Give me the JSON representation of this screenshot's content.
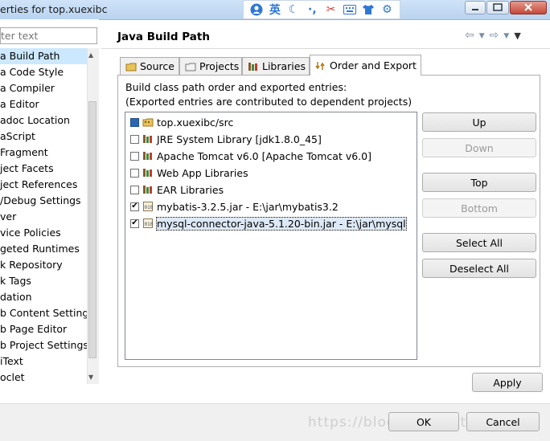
{
  "window": {
    "title": "erties for top.xuexibc",
    "ime_icons": [
      "user-icon",
      "ying-icon",
      "moon-icon",
      "dot-icon",
      "scissors-icon",
      "keyboard-icon",
      "shirt-icon",
      "gear-icon"
    ],
    "ime_ying": "英"
  },
  "left": {
    "filter_placeholder": "ter text",
    "items": [
      {
        "label": "a Build Path",
        "selected": true
      },
      {
        "label": "a Code Style"
      },
      {
        "label": "a Compiler"
      },
      {
        "label": "a Editor"
      },
      {
        "label": "adoc Location"
      },
      {
        "label": "aScript"
      },
      {
        "label": " Fragment"
      },
      {
        "label": "ject Facets"
      },
      {
        "label": "ject References"
      },
      {
        "label": "/Debug Settings"
      },
      {
        "label": "ver"
      },
      {
        "label": "vice Policies"
      },
      {
        "label": "geted Runtimes"
      },
      {
        "label": "k Repository"
      },
      {
        "label": "k Tags"
      },
      {
        "label": "dation"
      },
      {
        "label": "b Content Settings"
      },
      {
        "label": "b Page Editor"
      },
      {
        "label": "b Project Settings"
      },
      {
        "label": "iText"
      },
      {
        "label": "oclet"
      }
    ]
  },
  "header": {
    "title": "Java Build Path"
  },
  "tabs": [
    {
      "label": "Source"
    },
    {
      "label": "Projects"
    },
    {
      "label": "Libraries"
    },
    {
      "label": "Order and Export",
      "active": true
    }
  ],
  "order_export": {
    "line1": "Build class path order and exported entries:",
    "line2": "(Exported entries are contributed to dependent projects)",
    "entries": [
      {
        "label": "top.xuexibc/src",
        "checked": "filled",
        "icon": "source-folder-icon"
      },
      {
        "label": "JRE System Library [jdk1.8.0_45]",
        "checked": "no",
        "icon": "library-icon"
      },
      {
        "label": "Apache Tomcat v6.0 [Apache Tomcat v6.0]",
        "checked": "no",
        "icon": "library-icon"
      },
      {
        "label": "Web App Libraries",
        "checked": "no",
        "icon": "library-icon"
      },
      {
        "label": "EAR Libraries",
        "checked": "no",
        "icon": "library-icon"
      },
      {
        "label": "mybatis-3.2.5.jar - E:\\jar\\mybatis3.2",
        "checked": "yes",
        "icon": "jar-icon"
      },
      {
        "label": "mysql-connector-java-5.1.20-bin.jar - E:\\jar\\mysql",
        "checked": "yes",
        "icon": "jar-icon",
        "focused": true
      }
    ]
  },
  "buttons": {
    "up": "Up",
    "down": "Down",
    "top": "Top",
    "bottom": "Bottom",
    "select_all": "Select All",
    "deselect_all": "Deselect All",
    "apply": "Apply",
    "ok": "OK",
    "cancel": "Cancel"
  },
  "watermark": "https://blog.csdn.net/qq_2019",
  "colors": {
    "selection": "#cce8ff",
    "accent": "#2e78d4"
  }
}
